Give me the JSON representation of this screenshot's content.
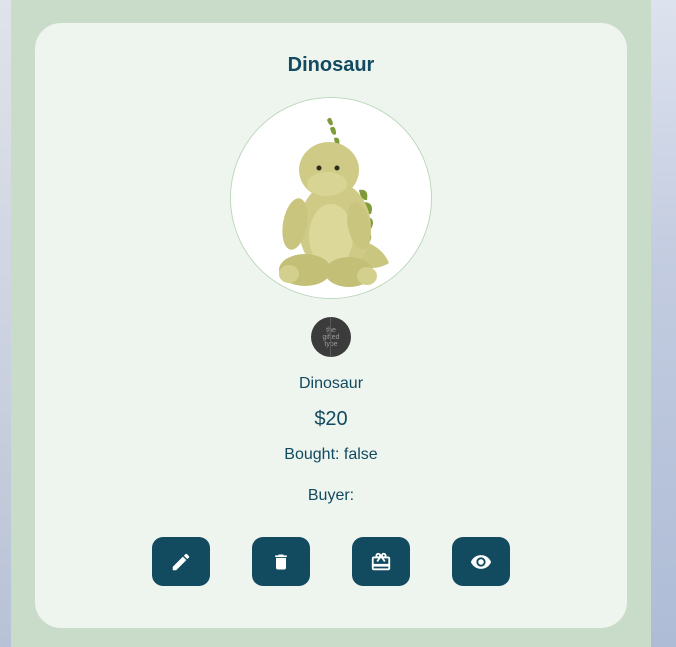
{
  "card": {
    "title": "Dinosaur",
    "item_name": "Dinosaur",
    "price": "$20",
    "bought_text": "Bought: false",
    "buyer_text": "Buyer: ",
    "logo_text": [
      "the",
      "gifted",
      "type"
    ]
  },
  "actions": [
    {
      "name": "edit",
      "icon": "pencil-icon"
    },
    {
      "name": "delete",
      "icon": "trash-icon"
    },
    {
      "name": "gift",
      "icon": "gift-icon"
    },
    {
      "name": "view",
      "icon": "eye-icon"
    }
  ],
  "colors": {
    "accent": "#124a5f",
    "panel_bg": "#c8dcc9",
    "card_bg": "#eef4ee",
    "text": "#124a60"
  }
}
